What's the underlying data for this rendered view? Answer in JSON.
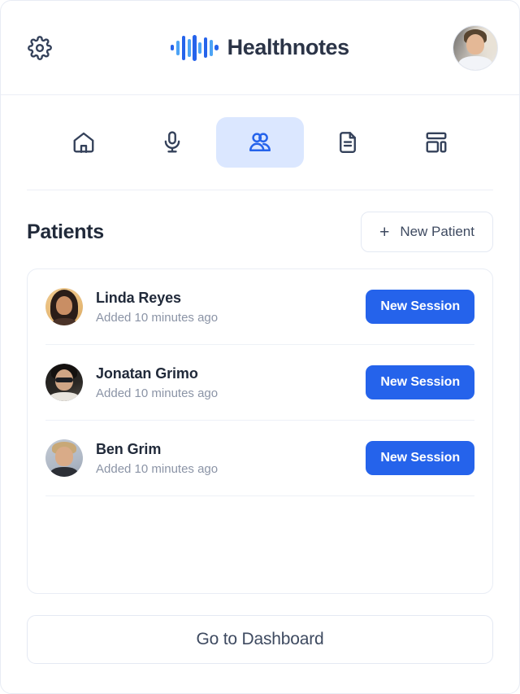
{
  "header": {
    "settings_icon": "gear-icon",
    "brand_name": "Healthnotes",
    "brand_logo_icon": "audio-waveform-icon",
    "avatar_icon": "user-avatar",
    "accent_color": "#2563eb",
    "logo_light_color": "#4da3f5"
  },
  "nav": {
    "items": [
      {
        "id": "home",
        "icon": "home-icon",
        "active": false
      },
      {
        "id": "record",
        "icon": "microphone-icon",
        "active": false
      },
      {
        "id": "patients",
        "icon": "users-icon",
        "active": true
      },
      {
        "id": "notes",
        "icon": "document-icon",
        "active": false
      },
      {
        "id": "dashboard",
        "icon": "layout-icon",
        "active": false
      }
    ],
    "active_bg_color": "#dbe7ff",
    "active_icon_color": "#2563eb",
    "icon_color": "#34415a"
  },
  "main": {
    "title": "Patients",
    "new_patient": {
      "label": "New Patient",
      "icon": "plus-icon"
    },
    "patients": [
      {
        "name": "Linda Reyes",
        "meta": "Added 10 minutes ago",
        "avatar": "linda-avatar",
        "action_label": "New Session"
      },
      {
        "name": "Jonatan Grimo",
        "meta": "Added 10 minutes ago",
        "avatar": "jonatan-avatar",
        "action_label": "New Session"
      },
      {
        "name": "Ben Grim",
        "meta": "Added 10 minutes ago",
        "avatar": "ben-avatar",
        "action_label": "New Session"
      }
    ]
  },
  "footer": {
    "dashboard_label": "Go to Dashboard"
  }
}
